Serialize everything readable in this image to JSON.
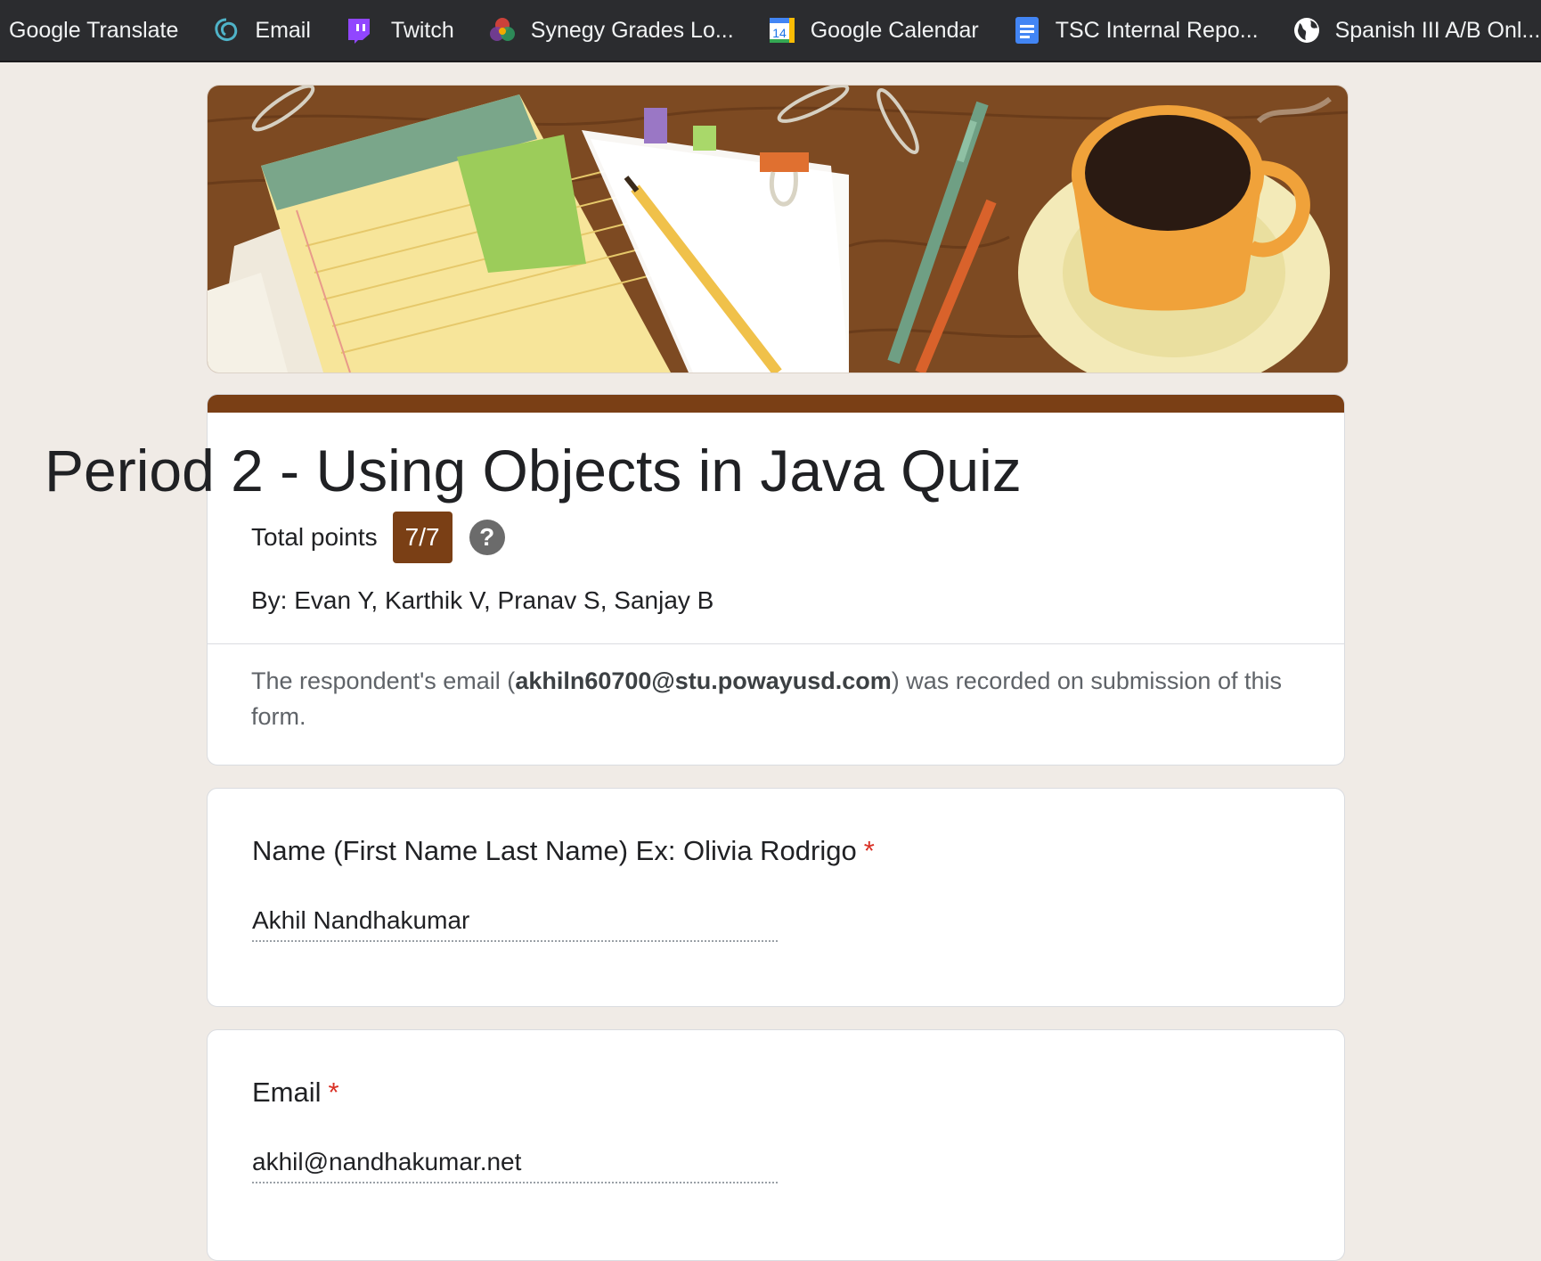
{
  "bookmarks": [
    {
      "label": "Google Translate",
      "icon": "none"
    },
    {
      "label": "Email",
      "icon": "email-logo-icon"
    },
    {
      "label": "Twitch",
      "icon": "twitch-icon"
    },
    {
      "label": "Synegy Grades Lo...",
      "icon": "synergy-icon"
    },
    {
      "label": "Google Calendar",
      "icon": "calendar-icon",
      "badge": "14"
    },
    {
      "label": "TSC Internal Repo...",
      "icon": "docs-icon"
    },
    {
      "label": "Spanish III A/B Onl...",
      "icon": "globe-icon"
    }
  ],
  "form": {
    "title": "Period 2 - Using Objects in Java Quiz",
    "points_label": "Total points",
    "score": "7/7",
    "help": "?",
    "description": "By: Evan Y, Karthik V, Pranav S, Sanjay B",
    "notice_prefix": "The respondent's email (",
    "notice_email": "akhiln60700@stu.powayusd.com",
    "notice_suffix": ") was recorded on submission of this form.",
    "accent_color": "#7a3f15"
  },
  "questions": [
    {
      "title": "Name (First Name Last Name) Ex: Olivia Rodrigo",
      "required": "*",
      "answer": "Akhil Nandhakumar"
    },
    {
      "title": "Email",
      "required": "*",
      "answer": "akhil@nandhakumar.net"
    }
  ]
}
